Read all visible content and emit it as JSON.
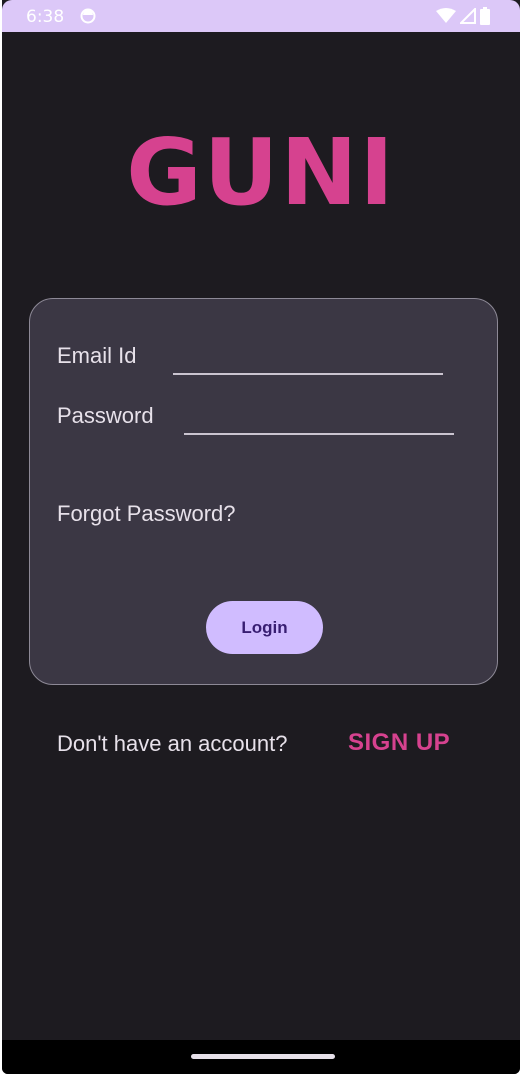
{
  "status_bar": {
    "time": "6:38",
    "icons": [
      "sync-icon",
      "wifi-icon",
      "cellular-icon",
      "battery-icon"
    ],
    "background": "#dcc8f8"
  },
  "logo": {
    "text": "GUNI",
    "color": "#d6428f"
  },
  "form": {
    "email_label": "Email Id",
    "email_value": "",
    "password_label": "Password",
    "password_value": "",
    "forgot_label": "Forgot Password?",
    "login_label": "Login"
  },
  "signup": {
    "prompt": "Don't have an account?",
    "link_label": "SIGN UP"
  },
  "colors": {
    "background": "#1d1b20",
    "card": "#3b3744",
    "accent": "#d6428f",
    "button": "#d0bcff",
    "button_text": "#381e72"
  }
}
